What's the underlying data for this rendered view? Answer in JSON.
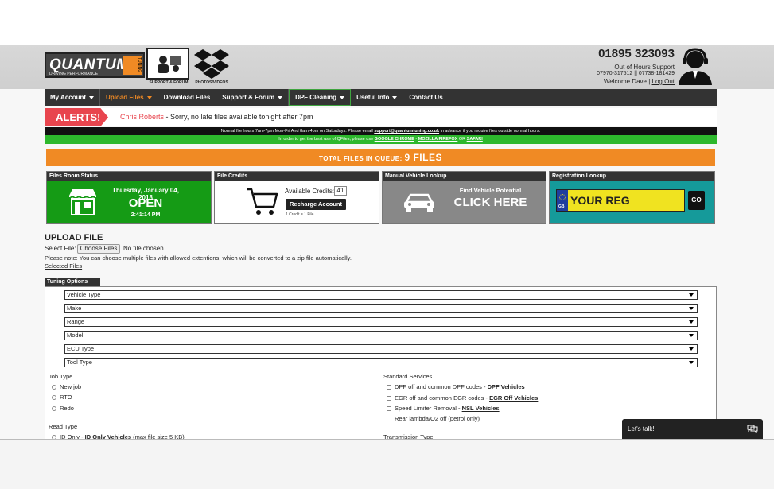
{
  "brand": {
    "logo_text": "QUANTUM",
    "logo_tag": "DRIVING PERFORMANCE",
    "logo_tuning": "TUNING",
    "support_label": "SUPPORT & FORUM",
    "photos_label": "PHOTOS/VIDEOS"
  },
  "contact": {
    "phone": "01895 323093",
    "out_of_hours": "Out of Hours Support",
    "ooh_numbers": "07970-317512 || 07738-181429",
    "welcome": "Welcome Dave |",
    "logout": "Log Out"
  },
  "nav": [
    {
      "label": "My Account"
    },
    {
      "label": "Upload Files"
    },
    {
      "label": "Download Files"
    },
    {
      "label": "Support & Forum"
    },
    {
      "label": "DPF Cleaning"
    },
    {
      "label": "Useful Info"
    },
    {
      "label": "Contact Us"
    }
  ],
  "alerts": {
    "tag": "ALERTS!",
    "name": "Chris Roberts",
    "message": " - Sorry, no late files available tonight after 7pm"
  },
  "hours_bar": {
    "pre": "Normal file hours 7am-7pm Mon-Fri And 8am-4pm on Saturdays. Please email ",
    "email": "support@quantumtuning.co.uk",
    "post": " in advance if you require files outside normal hours."
  },
  "browsers_bar": {
    "pre": "In order to get the best use of QFiles, please use ",
    "chrome": "GOOGLE CHROME",
    "sep1": " - ",
    "firefox": "MOZILLA FIREFOX",
    "sep2": " OR ",
    "safari": "SAFARI"
  },
  "queue": {
    "label": "TOTAL FILES IN QUEUE: ",
    "count": "9 FILES"
  },
  "panels": {
    "status": {
      "title": "Files Room Status",
      "date": "Thursday, January 04, 2018",
      "state": "OPEN",
      "time": "2:41:14 PM"
    },
    "credits": {
      "title": "File Credits",
      "available_label": "Available Credits:",
      "available_value": "41",
      "button": "Recharge Account",
      "note": "1 Credit = 1 File"
    },
    "lookup": {
      "title": "Manual Vehicle Lookup",
      "line1": "Find Vehicle Potential",
      "line2": "CLICK HERE"
    },
    "registration": {
      "title": "Registration Lookup",
      "country": "GB",
      "placeholder": "YOUR REG",
      "button": "GO"
    }
  },
  "upload": {
    "title": "UPLOAD FILE",
    "select_label": "Select File:",
    "choose_button": "Choose Files",
    "no_file": "No file chosen",
    "note": "Please note: You can choose multiple files with allowed extentions, which will be converted to a zip file automatically.",
    "selected_files": "Selected Files"
  },
  "tuning": {
    "tab": "Tuning Options",
    "selects": [
      "Vehicle Type",
      "Make",
      "Range",
      "Model",
      "ECU Type",
      "Tool Type"
    ],
    "job_type": {
      "title": "Job Type",
      "options": [
        "New job",
        "RTO",
        "Redo"
      ]
    },
    "read_type": {
      "title": "Read Type",
      "option_pre": "ID Only - ",
      "option_link": "ID Only Vehicles",
      "option_post": " (max file size 5 KB)"
    },
    "standard_services": {
      "title": "Standard Services",
      "items": [
        {
          "text": "DPF off and common DPF codes - ",
          "link": "DPF Vehicles"
        },
        {
          "text": "EGR off and common EGR codes - ",
          "link": "EGR Off Vehicles"
        },
        {
          "text": "Speed Limiter Removal - ",
          "link": "NSL Vehicles"
        },
        {
          "text": "Rear lambda/O2 off (petrol only)",
          "link": ""
        }
      ]
    },
    "transmission_type": "Transmission Type"
  },
  "chat": {
    "label": "Let's talk!"
  },
  "colors": {
    "orange": "#f08a24",
    "green": "#159b15",
    "teal": "#159a9a",
    "red": "#e8454e",
    "dark": "#333333"
  }
}
